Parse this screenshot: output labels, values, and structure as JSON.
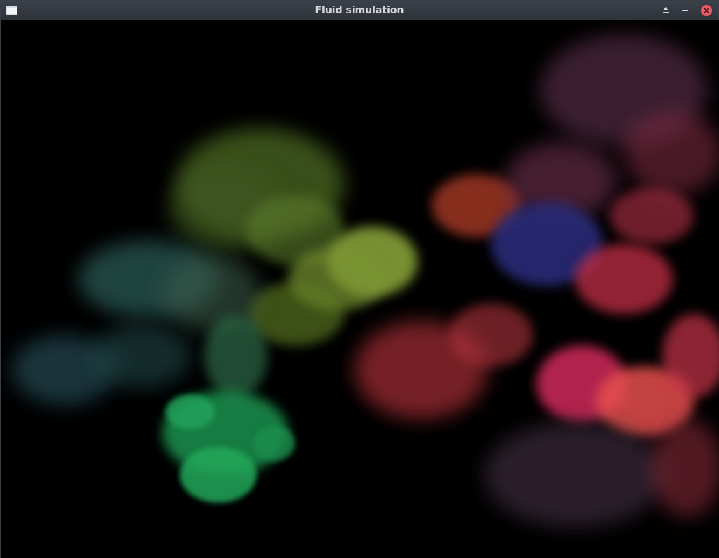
{
  "window": {
    "title": "Fluid simulation",
    "buttons": [
      {
        "name": "keep-above-button",
        "icon": "eject-icon"
      },
      {
        "name": "minimize-button",
        "icon": "minus-icon"
      },
      {
        "name": "close-button",
        "icon": "close-icon",
        "color": "#ea5a64"
      }
    ]
  },
  "scene": {
    "background": "#000000",
    "dye_colors": {
      "olive": "#4e6a24",
      "yellow_green": "#8ea83a",
      "teal": "#2c5a55",
      "slate_teal": "#22444e",
      "green": "#1f9b52",
      "orange_red": "#c0422c",
      "navy": "#2a2a78",
      "crimson": "#c42e47",
      "magenta": "#d12a5b",
      "coral": "#e5504d",
      "plum": "#5a2f4a",
      "dark_plum": "#3a2c3a"
    }
  }
}
